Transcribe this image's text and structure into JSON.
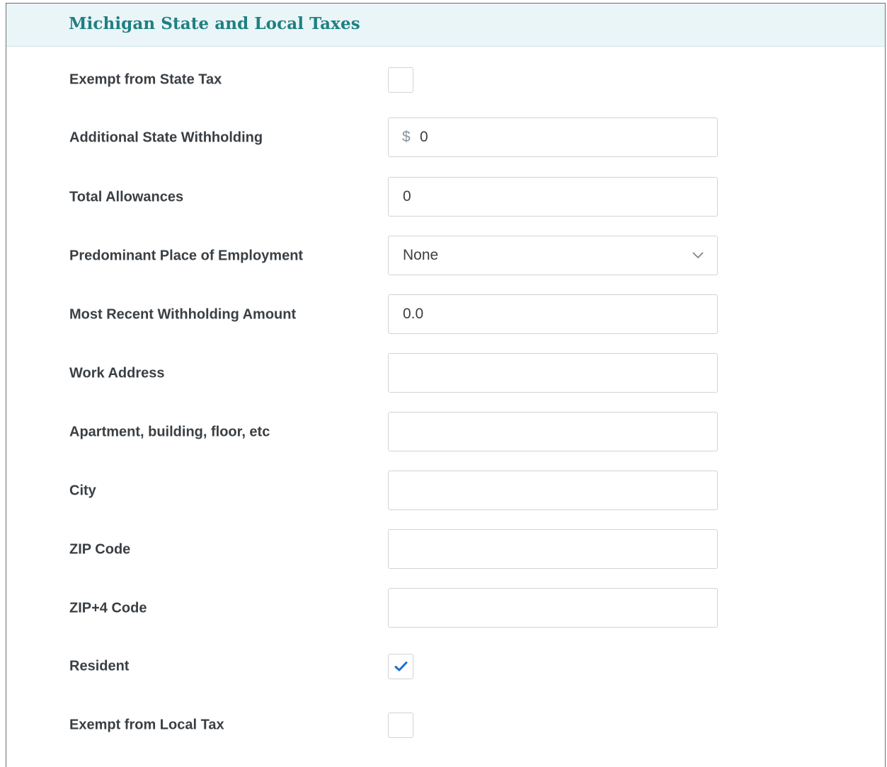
{
  "section": {
    "title": "Michigan State and Local Taxes"
  },
  "fields": {
    "exempt_state": {
      "label": "Exempt from State Tax",
      "checked": false
    },
    "additional_withholding": {
      "label": "Additional State Withholding",
      "prefix": "$",
      "value": "0"
    },
    "total_allowances": {
      "label": "Total Allowances",
      "value": "0"
    },
    "place_of_employment": {
      "label": "Predominant Place of Employment",
      "value": "None"
    },
    "recent_withholding": {
      "label": "Most Recent Withholding Amount",
      "value": "0.0"
    },
    "work_address": {
      "label": "Work Address",
      "value": ""
    },
    "apartment": {
      "label": "Apartment, building, floor, etc",
      "value": ""
    },
    "city": {
      "label": "City",
      "value": ""
    },
    "zip": {
      "label": "ZIP Code",
      "value": ""
    },
    "zip4": {
      "label": "ZIP+4 Code",
      "value": ""
    },
    "resident": {
      "label": "Resident",
      "checked": true
    },
    "exempt_local": {
      "label": "Exempt from Local Tax",
      "checked": false
    }
  },
  "colors": {
    "title": "#1f7f82",
    "header_bg": "#e9f5f7",
    "checkmark": "#1a6fd6"
  },
  "icons": {
    "select": "chevron-down-icon",
    "checked": "checkmark-icon"
  }
}
